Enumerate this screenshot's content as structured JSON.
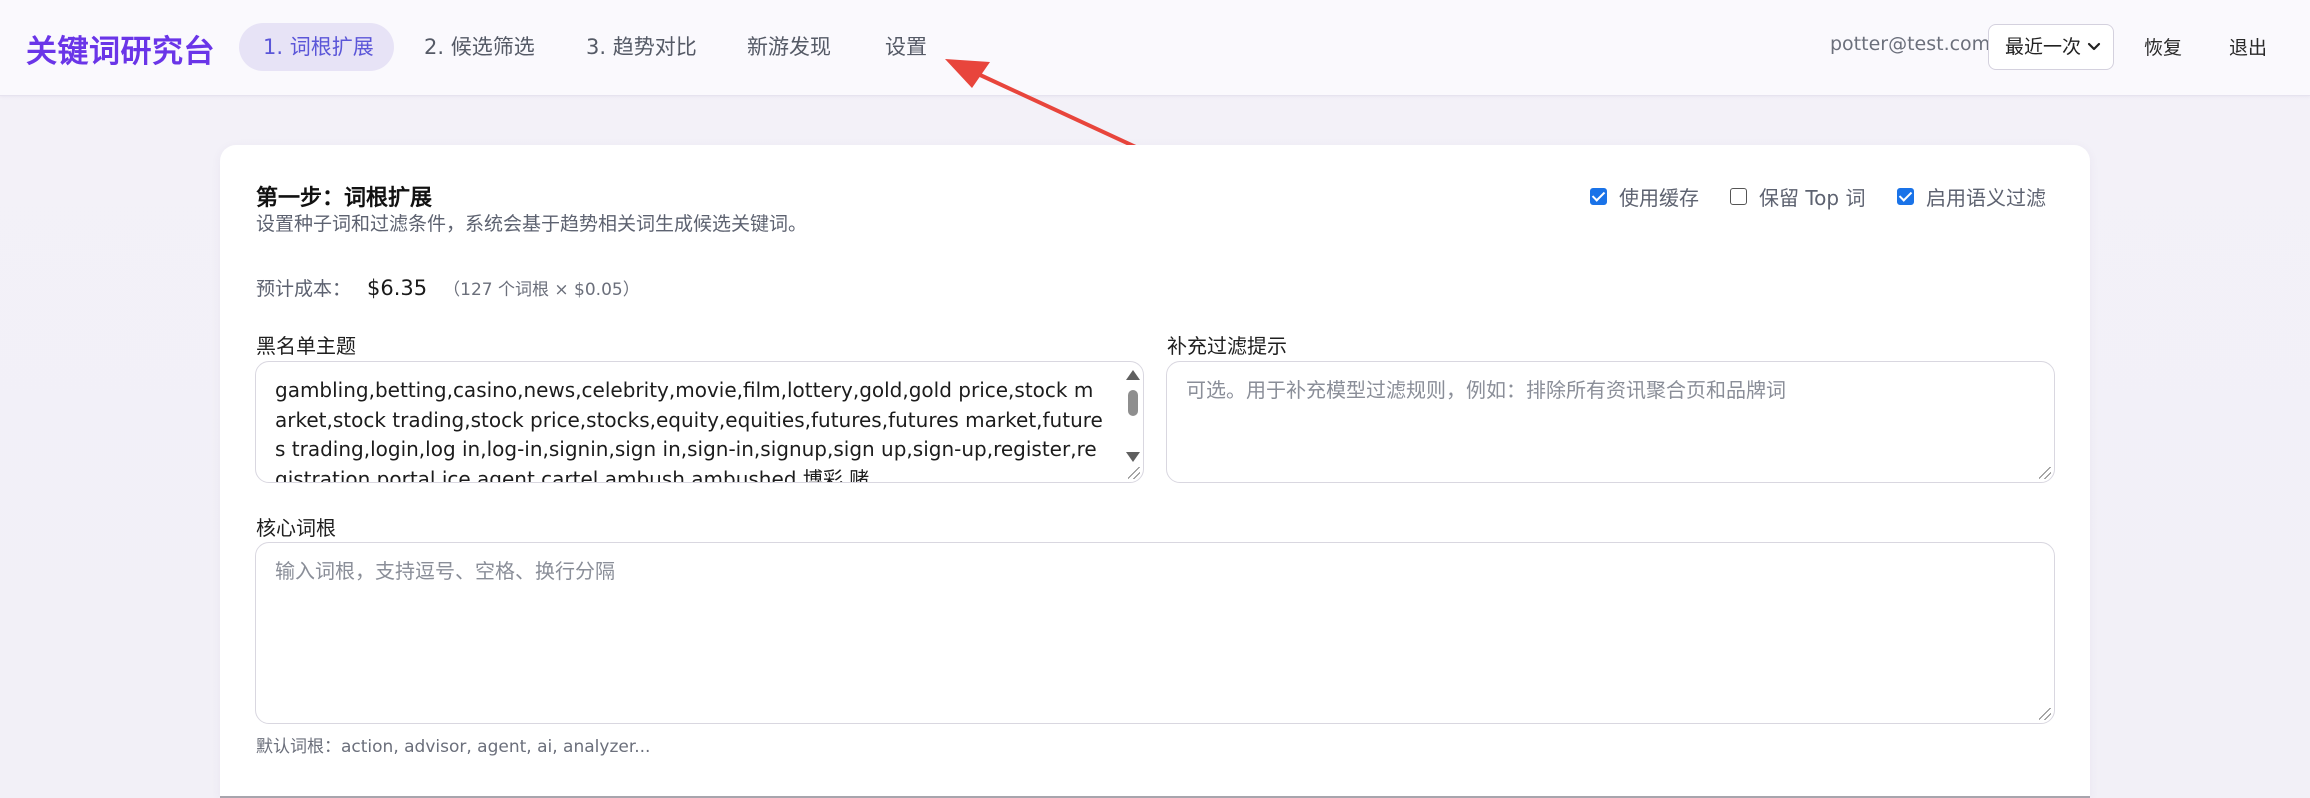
{
  "app": {
    "title": "关键词研究台"
  },
  "nav": {
    "items": [
      {
        "label": "1. 词根扩展",
        "active": true
      },
      {
        "label": "2. 候选筛选"
      },
      {
        "label": "3. 趋势对比"
      },
      {
        "label": "新游发现"
      },
      {
        "label": "设置"
      }
    ]
  },
  "header": {
    "user_email": "potter@test.com",
    "history_select": {
      "value": "最近一次",
      "icon": "chevron-down-icon"
    },
    "restore_label": "恢复",
    "logout_label": "退出"
  },
  "step": {
    "title": "第一步：词根扩展",
    "description": "设置种子词和过滤条件，系统会基于趋势相关词生成候选关键词。",
    "options": [
      {
        "label": "使用缓存",
        "checked": true
      },
      {
        "label": "保留 Top 词",
        "checked": false
      },
      {
        "label": "启用语义过滤",
        "checked": true
      }
    ],
    "cost": {
      "label": "预计成本：",
      "value": "$6.35",
      "detail": "（127 个词根 × $0.05）"
    }
  },
  "fields": {
    "blacklist": {
      "label": "黑名单主题",
      "value": "gambling,betting,casino,news,celebrity,movie,film,lottery,gold,gold price,stock market,stock trading,stock price,stocks,equity,equities,futures,futures market,futures trading,login,log in,log-in,signin,sign in,sign-in,signup,sign up,sign-up,register,registration,portal,ice agent,cartel,ambush,ambushed,博彩,赌"
    },
    "extra_filter": {
      "label": "补充过滤提示",
      "placeholder": "可选。用于补充模型过滤规则，例如：排除所有资讯聚合页和品牌词"
    },
    "core_roots": {
      "label": "核心词根",
      "placeholder": "输入词根，支持逗号、空格、换行分隔",
      "hint": "默认词根：action, advisor, agent, ai, analyzer..."
    }
  },
  "colors": {
    "brand": "#6a35e8",
    "active_tab_bg": "#e7e3f6",
    "active_tab_text": "#5b56d8",
    "checkbox": "#1a73e8",
    "annotation_arrow": "#e8453c"
  }
}
